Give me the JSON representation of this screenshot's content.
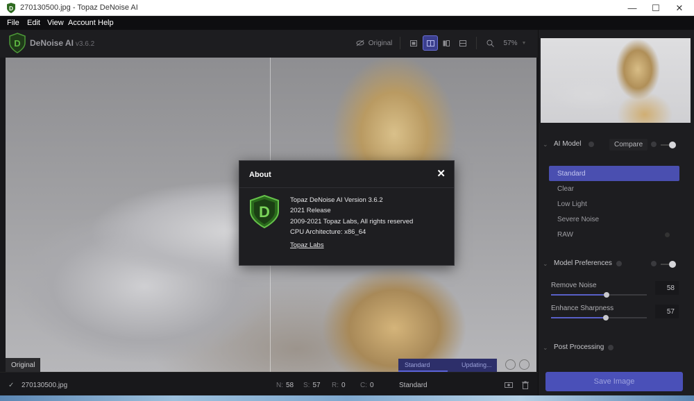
{
  "window": {
    "title": "270130500.jpg - Topaz DeNoise AI",
    "minimize_glyph": "—",
    "maximize_glyph": "☐",
    "close_glyph": "✕"
  },
  "menu": [
    {
      "label": "File"
    },
    {
      "label": "Edit"
    },
    {
      "label": "View"
    },
    {
      "label": "Account"
    },
    {
      "label": "Help"
    }
  ],
  "brand": {
    "name": "DeNoise AI",
    "version": "v3.6.2"
  },
  "toolbar": {
    "original_label": "Original",
    "zoom": "57%"
  },
  "viewer": {
    "original_tag": "Original"
  },
  "processing": {
    "model": "Standard",
    "status": "Updating...",
    "progress": 0.5
  },
  "bottom": {
    "filename": "270130500.jpg",
    "stats": [
      {
        "k": "N:",
        "v": "58"
      },
      {
        "k": "S:",
        "v": "57"
      },
      {
        "k": "R:",
        "v": "0"
      },
      {
        "k": "C:",
        "v": "0"
      }
    ],
    "model": "Standard"
  },
  "panel": {
    "ai_model_label": "AI Model",
    "compare_label": "Compare",
    "models": [
      "Standard",
      "Clear",
      "Low Light",
      "Severe Noise",
      "RAW"
    ],
    "selected_model": "Standard",
    "model_prefs_label": "Model Preferences",
    "remove_noise": {
      "label": "Remove Noise",
      "value": "58",
      "level": 0.58
    },
    "enhance_sharpness": {
      "label": "Enhance Sharpness",
      "value": "57",
      "level": 0.57
    },
    "post_processing_label": "Post Processing",
    "save_label": "Save Image"
  },
  "about": {
    "title": "About",
    "close_glyph": "✕",
    "lines": [
      "Topaz DeNoise AI Version 3.6.2",
      "2021 Release",
      "2009-2021 Topaz Labs, All rights reserved",
      "CPU Architecture: x86_64"
    ],
    "link": "Topaz Labs"
  },
  "colors": {
    "accent": "#4a50b8",
    "dialog_bg": "#1e1e21",
    "logo_green": "#3fae2a"
  }
}
